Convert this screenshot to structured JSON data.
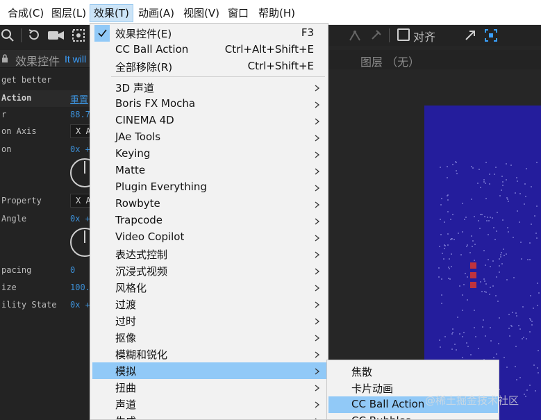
{
  "menubar": {
    "items": [
      {
        "label": "合成(C)"
      },
      {
        "label": "图层(L)"
      },
      {
        "label": "效果(T)",
        "active": true
      },
      {
        "label": "动画(A)"
      },
      {
        "label": "视图(V)"
      },
      {
        "label": "窗口"
      },
      {
        "label": "帮助(H)"
      }
    ]
  },
  "toolbar": {
    "align_label": "对齐",
    "icons": [
      "search-icon",
      "rotate-icon",
      "camera-icon",
      "pan-behind-icon",
      "puppet-icon",
      "pin-icon",
      "align-checkbox",
      "expand-icon",
      "snap-icon"
    ]
  },
  "effect_panel": {
    "tab_title": "效果控件",
    "tab_layer": "It will",
    "layer_name": "get better",
    "effect_name": "Action",
    "reset_label": "重置",
    "rows": [
      {
        "name": "r",
        "value": "88.7"
      },
      {
        "name": "on Axis",
        "box": "X A"
      },
      {
        "name": "on",
        "value": "0x +"
      },
      {
        "name": "Property",
        "box": "X A"
      },
      {
        "name": "Angle",
        "value": "0x +"
      },
      {
        "name": "pacing",
        "value": "0"
      },
      {
        "name": "ize",
        "value": "100."
      },
      {
        "name": "ility State",
        "value": "0x +"
      }
    ]
  },
  "composition": {
    "header": "图层 （无）"
  },
  "effect_menu": {
    "items": [
      {
        "label": "效果控件(E)",
        "shortcut": "F3",
        "checked": true
      },
      {
        "label": "CC Ball Action",
        "shortcut": "Ctrl+Alt+Shift+E"
      },
      {
        "label": "全部移除(R)",
        "shortcut": "Ctrl+Shift+E"
      },
      {
        "label": "3D 声道",
        "submenu": true
      },
      {
        "label": "Boris FX Mocha",
        "submenu": true
      },
      {
        "label": "CINEMA 4D",
        "submenu": true
      },
      {
        "label": "JAe Tools",
        "submenu": true
      },
      {
        "label": "Keying",
        "submenu": true
      },
      {
        "label": "Matte",
        "submenu": true
      },
      {
        "label": "Plugin Everything",
        "submenu": true
      },
      {
        "label": "Rowbyte",
        "submenu": true
      },
      {
        "label": "Trapcode",
        "submenu": true
      },
      {
        "label": "Video Copilot",
        "submenu": true
      },
      {
        "label": "表达式控制",
        "submenu": true
      },
      {
        "label": "沉浸式视频",
        "submenu": true
      },
      {
        "label": "风格化",
        "submenu": true
      },
      {
        "label": "过渡",
        "submenu": true
      },
      {
        "label": "过时",
        "submenu": true
      },
      {
        "label": "抠像",
        "submenu": true
      },
      {
        "label": "模糊和锐化",
        "submenu": true
      },
      {
        "label": "模拟",
        "submenu": true,
        "highlighted": true
      },
      {
        "label": "扭曲",
        "submenu": true
      },
      {
        "label": "声道",
        "submenu": true
      },
      {
        "label": "生成",
        "submenu": true
      }
    ]
  },
  "simulation_submenu": {
    "items": [
      {
        "label": "焦散"
      },
      {
        "label": "卡片动画"
      },
      {
        "label": "CC Ball Action",
        "highlighted": true
      },
      {
        "label": "CC Bubbles"
      }
    ]
  },
  "watermark": "@稀土掘金技术社区",
  "colors": {
    "menu_highlight": "#91c9f7",
    "menubar_active": "#cce4f7",
    "canvas_bg": "#241d9c",
    "particle": "#c0333d",
    "link_blue": "#3c8fd6"
  }
}
